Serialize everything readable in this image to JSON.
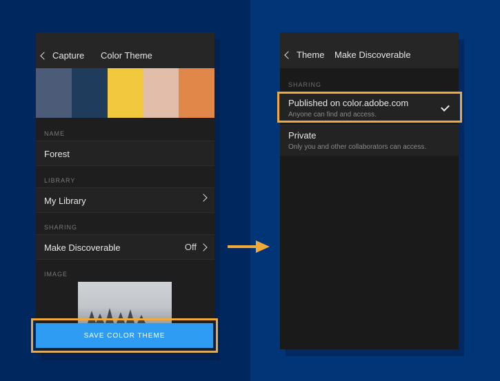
{
  "left_screen": {
    "back_label": "Capture",
    "title": "Color Theme",
    "swatches": [
      "#4b5b78",
      "#1f3c5c",
      "#f2c93d",
      "#e2bda9",
      "#e0874a"
    ],
    "name_section": "NAME",
    "name_value": "Forest",
    "library_section": "LIBRARY",
    "library_value": "My Library",
    "sharing_section": "SHARING",
    "sharing_label": "Make Discoverable",
    "sharing_value": "Off",
    "image_section": "IMAGE",
    "save_label": "SAVE COLOR THEME"
  },
  "right_screen": {
    "back_label": "Theme",
    "title": "Make Discoverable",
    "section": "SHARING",
    "options": [
      {
        "title": "Published on color.adobe.com",
        "subtitle": "Anyone can find and access.",
        "selected": true
      },
      {
        "title": "Private",
        "subtitle": "Only you and other collaborators can access.",
        "selected": false
      }
    ]
  },
  "colors": {
    "accent": "#f2a93b",
    "button": "#2f9cf3"
  }
}
